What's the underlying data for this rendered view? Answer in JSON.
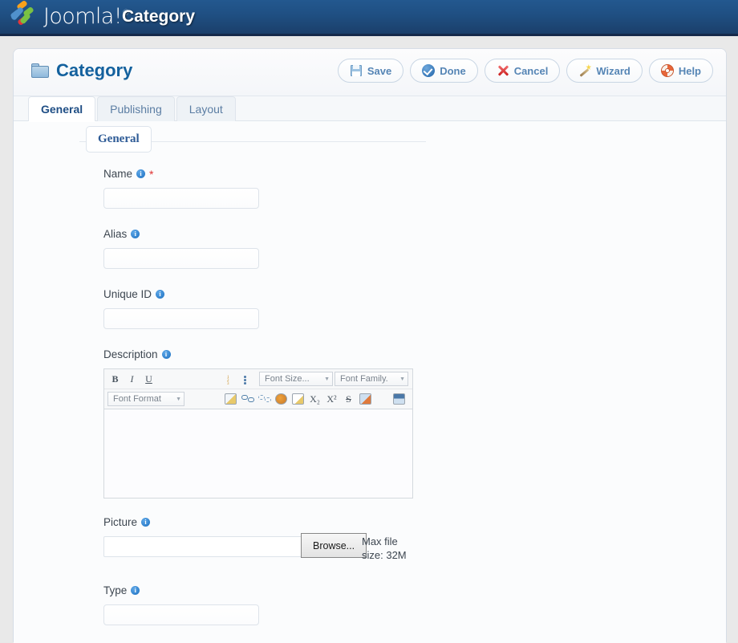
{
  "header": {
    "brand": "Joomla!",
    "brand_reg": "®",
    "page_title": "Category"
  },
  "panel": {
    "title": "Category",
    "folder_icon": "folder-icon",
    "toolbar": [
      {
        "label": "Save",
        "icon": "floppy-disk-icon"
      },
      {
        "label": "Done",
        "icon": "check-circle-icon"
      },
      {
        "label": "Cancel",
        "icon": "red-x-icon"
      },
      {
        "label": "Wizard",
        "icon": "magic-wand-icon"
      },
      {
        "label": "Help",
        "icon": "life-ring-icon"
      }
    ]
  },
  "tabs": [
    {
      "label": "General",
      "active": true
    },
    {
      "label": "Publishing",
      "active": false
    },
    {
      "label": "Layout",
      "active": false
    }
  ],
  "fieldset": {
    "legend": "General"
  },
  "fields": {
    "name": {
      "label": "Name",
      "value": "",
      "required_mark": "*",
      "info_glyph": "i"
    },
    "alias": {
      "label": "Alias",
      "value": "",
      "info_glyph": "i"
    },
    "unique_id": {
      "label": "Unique ID",
      "value": "",
      "info_glyph": "i"
    },
    "description": {
      "label": "Description",
      "info_glyph": "i",
      "content": ""
    },
    "picture": {
      "label": "Picture",
      "info_glyph": "i",
      "value": "",
      "browse_label": "Browse...",
      "max_file_line1": "Max file",
      "max_file_line2": "size: 32M"
    },
    "type": {
      "label": "Type",
      "value": "",
      "info_glyph": "i"
    }
  },
  "editor": {
    "row1": [
      {
        "name": "bold-icon",
        "glyph": "B"
      },
      {
        "name": "italic-icon",
        "glyph": "I"
      },
      {
        "name": "underline-icon",
        "glyph": "U"
      },
      {
        "name": "align-left-icon",
        "glyph": ""
      },
      {
        "name": "align-center-icon",
        "glyph": ""
      },
      {
        "name": "align-right-icon",
        "glyph": ""
      },
      {
        "name": "align-justify-icon",
        "glyph": ""
      },
      {
        "name": "ordered-list-icon",
        "glyph": ""
      },
      {
        "name": "unordered-list-icon",
        "glyph": ""
      }
    ],
    "font_size_label": "Font Size...",
    "font_family_label": "Font Family.",
    "font_format_label": "Font Format",
    "row2": [
      {
        "name": "outdent-icon"
      },
      {
        "name": "indent-icon"
      },
      {
        "name": "paste-from-word-icon"
      },
      {
        "name": "insert-link-icon"
      },
      {
        "name": "unlink-icon"
      },
      {
        "name": "text-color-icon"
      },
      {
        "name": "edit-source-icon"
      },
      {
        "name": "subscript-icon",
        "glyph": "X₂"
      },
      {
        "name": "superscript-icon",
        "glyph": "X²"
      },
      {
        "name": "strikethrough-icon",
        "glyph": "S"
      },
      {
        "name": "remove-format-icon"
      },
      {
        "name": "horizontal-rule-icon"
      },
      {
        "name": "insert-image-icon"
      }
    ]
  },
  "colors": {
    "header_blue": "#1f4f82",
    "title_blue": "#14619e",
    "accent_blue": "#5585b5",
    "required_red": "#e03131",
    "info_blue": "#1b6fc0"
  }
}
